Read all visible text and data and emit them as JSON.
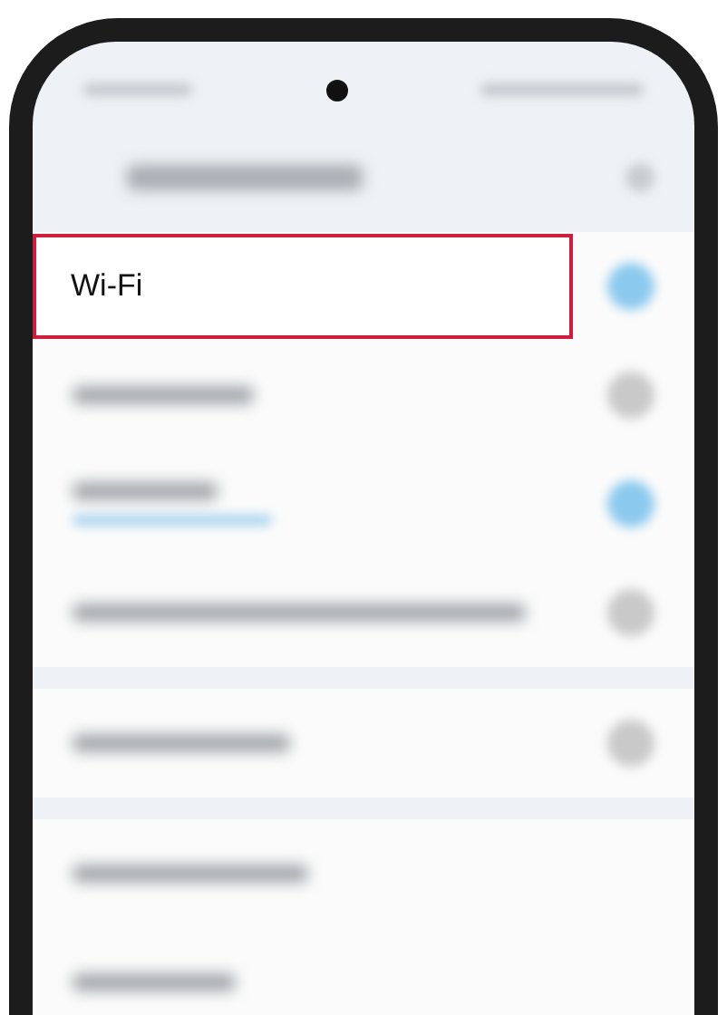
{
  "settings_rows": [
    {
      "label": "Wi-Fi",
      "on": true,
      "highlighted": true
    },
    {
      "on": false,
      "highlighted": false
    },
    {
      "on": true,
      "highlighted": false,
      "subtitle": true
    },
    {
      "on": false,
      "highlighted": false
    },
    {
      "on": false,
      "highlighted": false,
      "group_end": true
    },
    {
      "highlighted": false
    },
    {
      "highlighted": false
    }
  ]
}
